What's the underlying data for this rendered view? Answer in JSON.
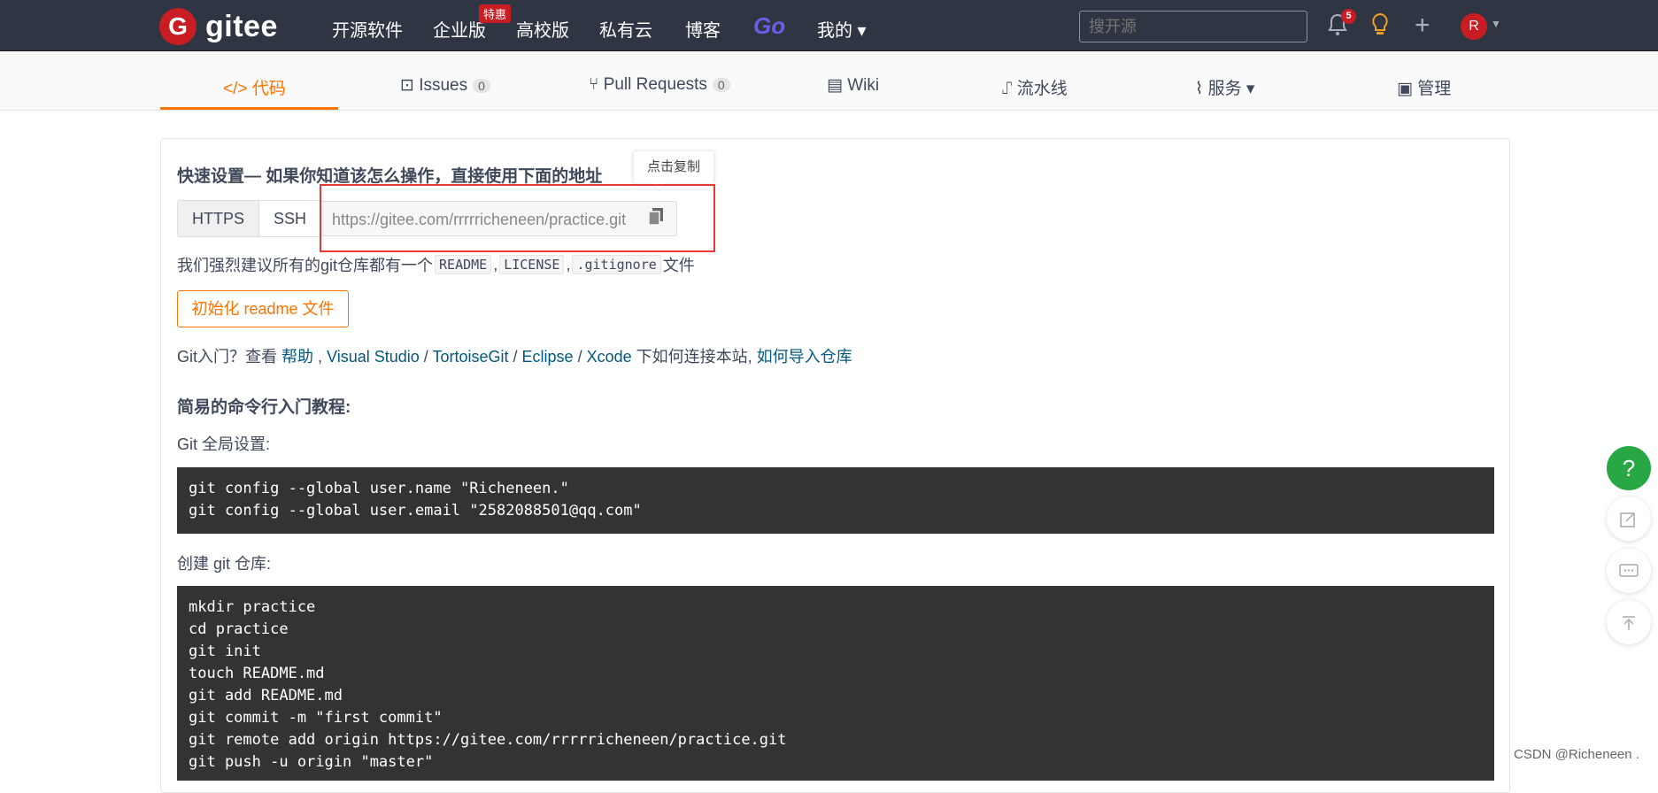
{
  "nav": {
    "logo_letter": "G",
    "logo_text": "gitee",
    "items": [
      "开源软件",
      "企业版",
      "高校版",
      "私有云",
      "博客"
    ],
    "hot_badge": "特惠",
    "go_label": "Go",
    "mine_label": "我的 ▾",
    "search_placeholder": "搜开源",
    "notif_count": "5",
    "avatar_letter": "R"
  },
  "tabs": [
    {
      "label": "</> 代码",
      "active": true
    },
    {
      "label": "Issues",
      "count": "0"
    },
    {
      "label": "Pull Requests",
      "count": "0"
    },
    {
      "label": "Wiki"
    },
    {
      "label": "流水线"
    },
    {
      "label": "服务 ▾"
    },
    {
      "label": "管理"
    }
  ],
  "quick": {
    "heading": "快速设置— 如果你知道该怎么操作，直接使用下面的地址",
    "https": "HTTPS",
    "ssh": "SSH",
    "url": "https://gitee.com/rrrrricheneen/practice.git",
    "tooltip": "点击复制",
    "recommend_prefix": "我们强烈建议所有的git仓库都有一个",
    "readme": "README",
    "license": "LICENSE",
    "gitignore": ".gitignore",
    "recommend_suffix": "文件",
    "init_button": "初始化 readme 文件"
  },
  "help": {
    "prefix": "Git入门？查看",
    "help_link": "帮助",
    "vs": "Visual Studio",
    "tortoise": "TortoiseGit",
    "eclipse": "Eclipse",
    "xcode": "Xcode",
    "mid": "下如何连接本站,",
    "import_link": "如何导入仓库"
  },
  "tutorial": {
    "heading": "简易的命令行入门教程:",
    "global_label": "Git 全局设置:",
    "global_code": "git config --global user.name \"Richeneen.\"\ngit config --global user.email \"2582088501@qq.com\"",
    "create_label": "创建 git 仓库:",
    "create_code": "mkdir practice\ncd practice\ngit init\ntouch README.md\ngit add README.md\ngit commit -m \"first commit\"\ngit remote add origin https://gitee.com/rrrrricheneen/practice.git\ngit push -u origin \"master\""
  },
  "float": {
    "help": "?",
    "edit_icon": "edit-icon",
    "chat_icon": "chat-icon",
    "top_icon": "back-to-top-icon"
  },
  "watermark": "CSDN @Richeneen ."
}
